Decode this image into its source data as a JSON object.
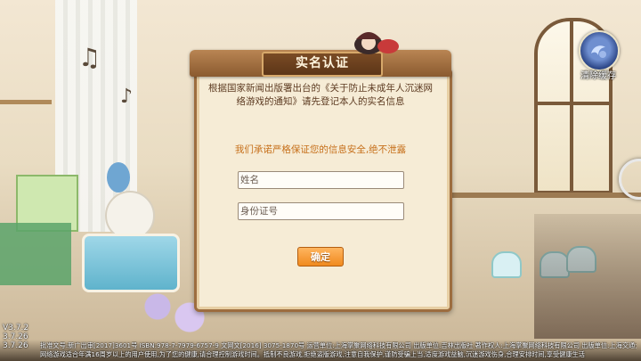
{
  "dialog": {
    "title": "实名认证",
    "notice": "根据国家新闻出版署出台的《关于防止未成年人沉迷网络游戏的通知》请先登记本人的实名信息",
    "promise": "我们承诺严格保证您的信息安全,绝不泄露",
    "name_placeholder": "姓名",
    "id_placeholder": "身份证号",
    "confirm_label": "确定"
  },
  "cache_button": {
    "label": "清除缓存",
    "icon": "clear-cache-icon"
  },
  "versions": [
    "V3.7.2",
    "3.7.26",
    "3.7.26"
  ],
  "footer": {
    "line1": "批准文号:新广出审[2017]3601号 ISBN:978-7-7979-6757-9 文网文[2016] 3075-1870号 运营单位:上海掌聚网络科技有限公司 出版单位:吉林出版社 著作权人:上海掌聚网络科技有限公司 出版单位:上海交通大学电子音像出版社有限公司",
    "line2": "网络游戏适合年满16周岁以上的用户使用,为了您的健康,请合理控制游戏时间。抵制不良游戏,拒绝盗版游戏,注意自我保护,谨防受骗上当,适度游戏益脑,沉迷游戏伤身,合理安排时间,享受健康生活"
  },
  "colors": {
    "dialog_bg": "#f6ecd6",
    "dialog_border": "#9d6d3f",
    "promise_text": "#c66f1a",
    "button": "#f08a1e"
  }
}
